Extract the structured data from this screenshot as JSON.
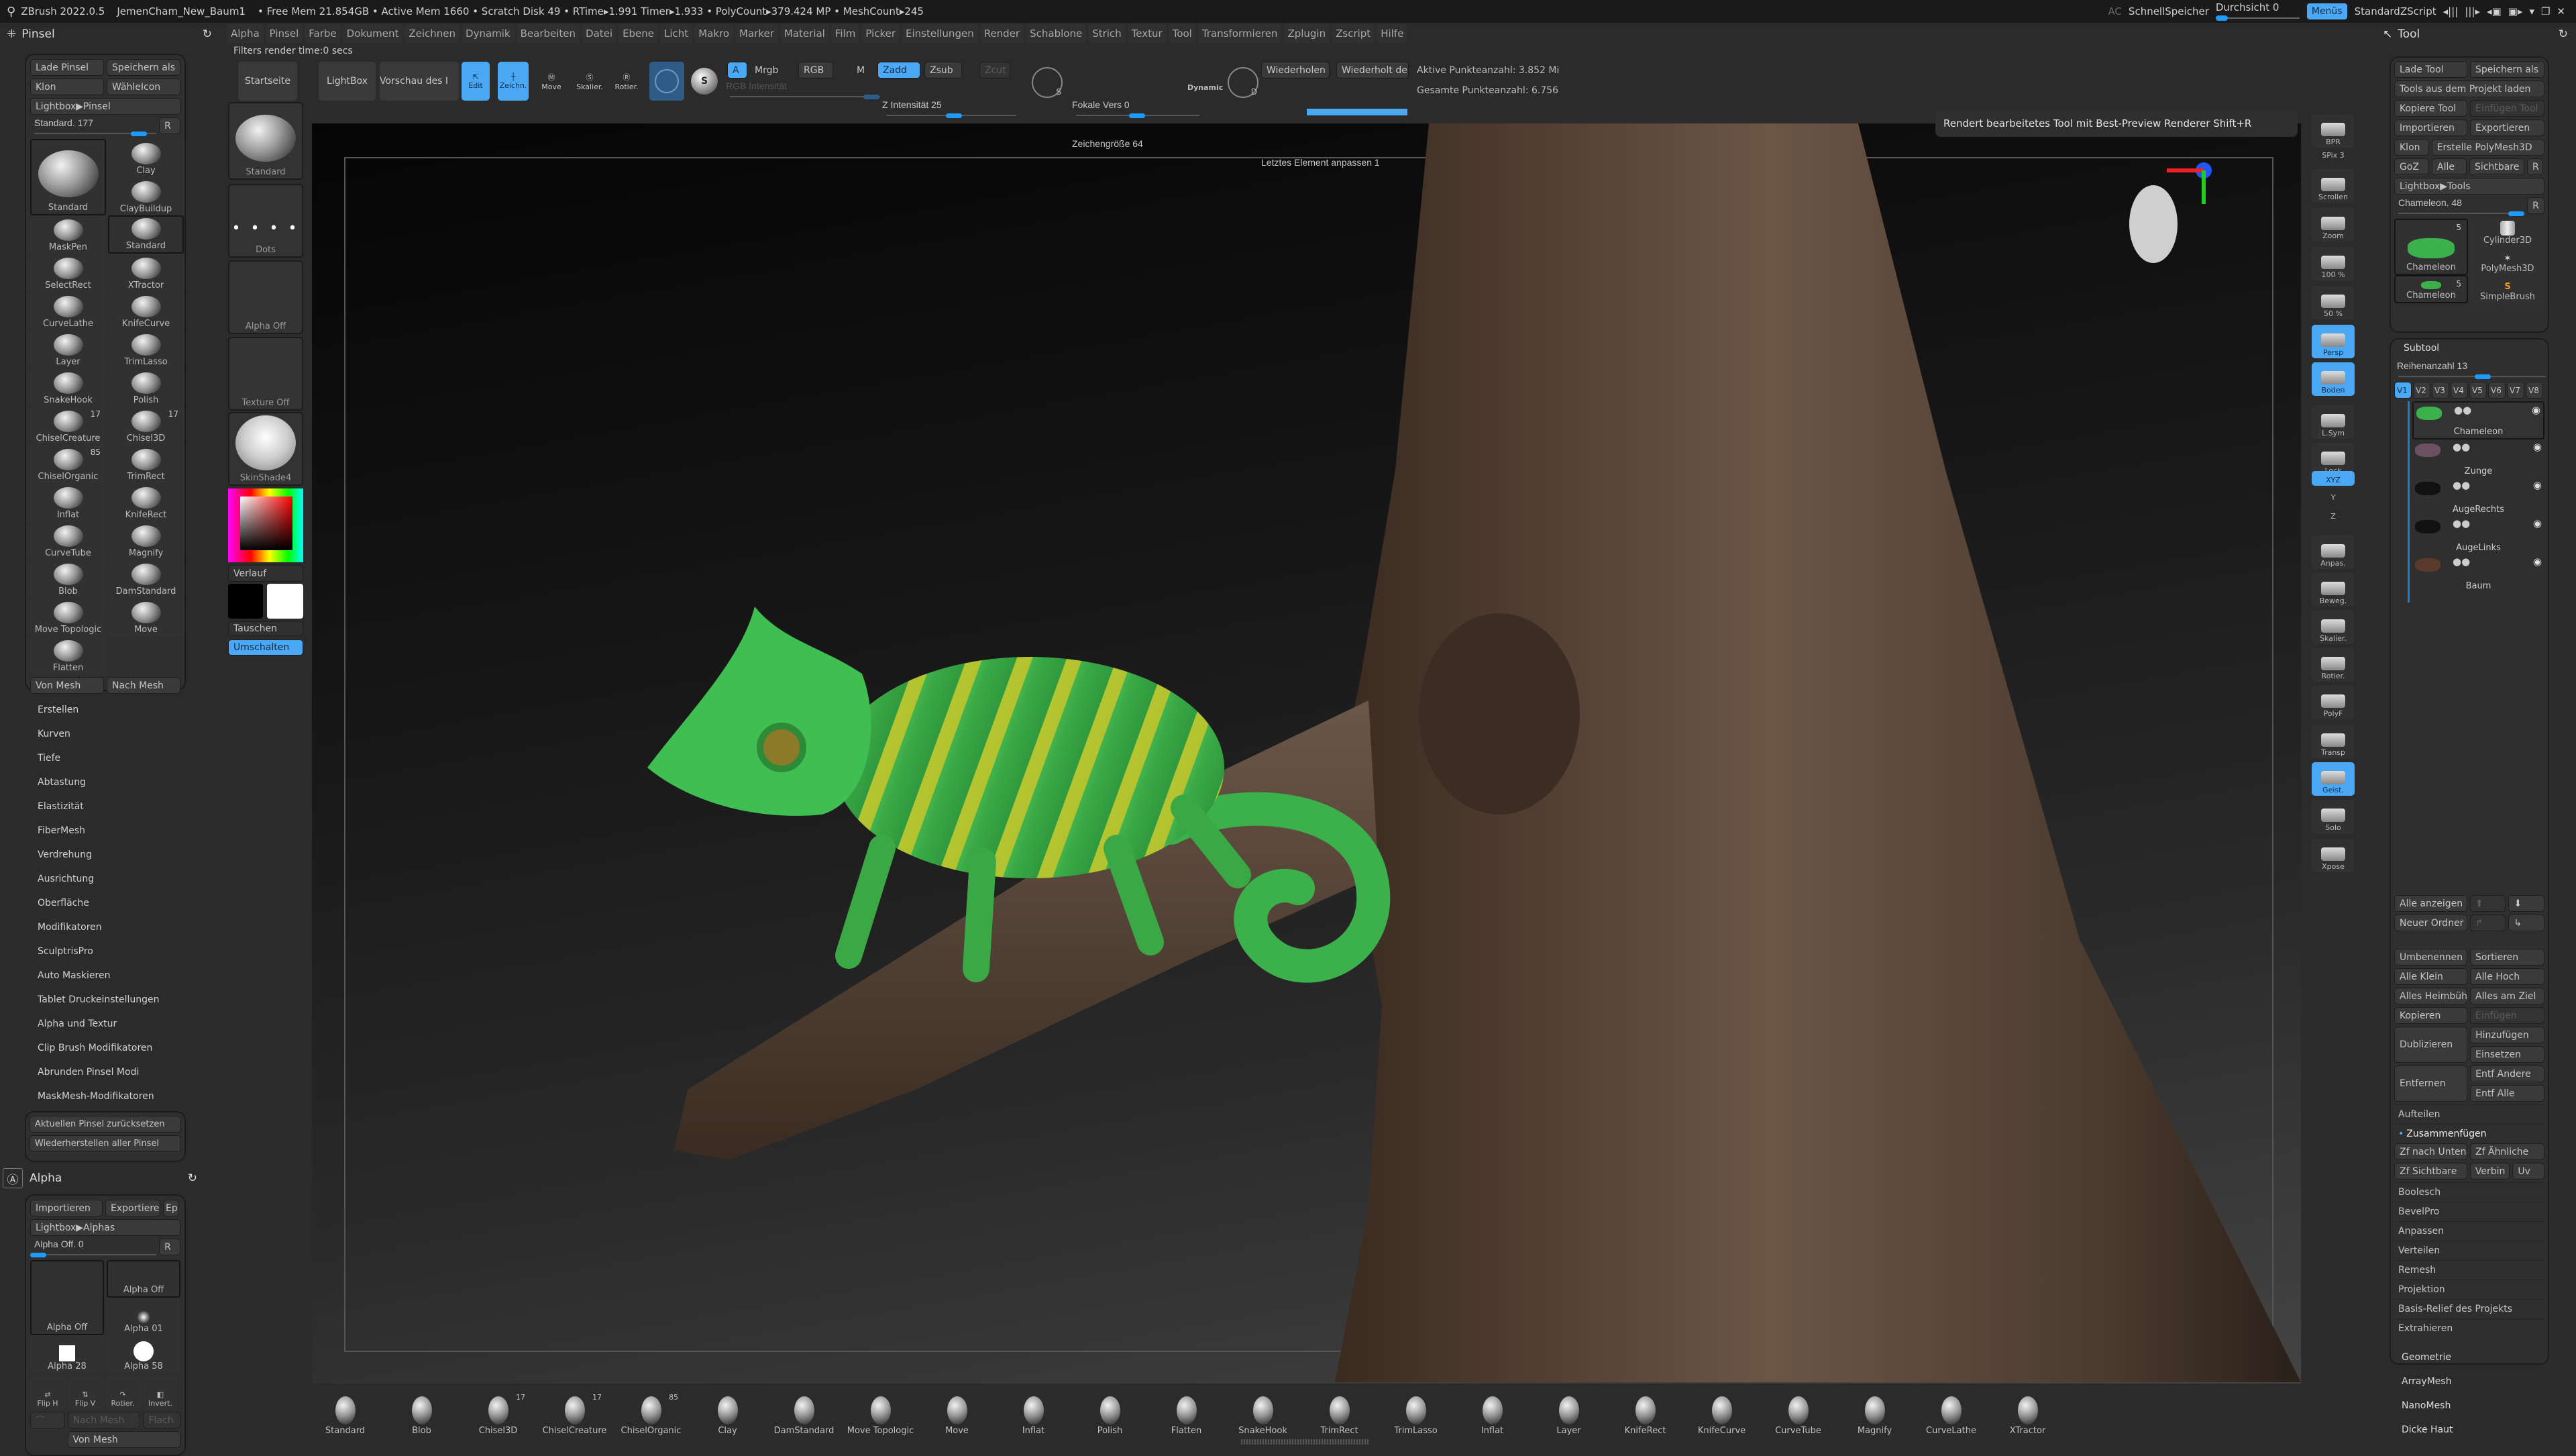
{
  "titlebar": {
    "app": "ZBrush 2022.0.5",
    "project": "JemenCham_New_Baum1",
    "stats": "• Free Mem 21.854GB • Active Mem 1660 • Scratch Disk 49 • RTime▸1.991 Timer▸1.933 • PolyCount▸379.424 MP • MeshCount▸245",
    "ac": "AC",
    "quicksave": "SchnellSpeicher",
    "transparency": "Durchsicht 0",
    "transparency_value": 0,
    "menus": "Menüs",
    "zscript": "StandardZScript"
  },
  "menubar": [
    "Alpha",
    "Pinsel",
    "Farbe",
    "Dokument",
    "Zeichnen",
    "Dynamik",
    "Bearbeiten",
    "Datei",
    "Ebene",
    "Licht",
    "Makro",
    "Marker",
    "Material",
    "Film",
    "Picker",
    "Einstellungen",
    "Render",
    "Schablone",
    "Strich",
    "Textur",
    "Tool",
    "Transformieren",
    "Zplugin",
    "Zscript",
    "Hilfe"
  ],
  "status": "Filters render time:0 secs",
  "toolbar": {
    "home": "Startseite",
    "lightbox": "LightBox",
    "preview": "Vorschau des I",
    "edit": "Edit",
    "draw": "Zeichn.",
    "move": "Move",
    "scale": "Skalier.",
    "rotate": "Rotier.",
    "a": "A",
    "mrgb": "Mrgb",
    "rgb": "RGB",
    "m": "M",
    "zadd": "Zadd",
    "zsub": "Zsub",
    "zcut": "Zcut",
    "rgb_intensity": "RGB Intensität",
    "z_intensity": "Z Intensität 25",
    "z_intensity_value": 25,
    "focal": "Fokale Vers 0",
    "draw_size": "Zeichengröße 64",
    "dynamic": "Dynamic",
    "repeat": "Wiederholen",
    "repeat_last": "Wiederholt de",
    "adjust_last": "Letztes Element anpassen 1",
    "active_points": "Aktive Punkteanzahl: 3.852 Mi",
    "total_points": "Gesamte Punkteanzahl: 6.756"
  },
  "tooltip": "Rendert bearbeitetes Tool mit Best-Preview Renderer  Shift+R",
  "brush_panel": {
    "title": "Pinsel",
    "load": "Lade Pinsel",
    "save_as": "Speichern als",
    "clone": "Klon",
    "select_icon": "WähleIcon",
    "lightbox": "Lightbox▶Pinsel",
    "slider": "Standard. 177",
    "r": "R",
    "brushes": [
      {
        "name": "Standard",
        "big": true
      },
      {
        "name": "Clay"
      },
      {
        "name": "ClayBuildup"
      },
      {
        "name": "MaskPen"
      },
      {
        "name": "Standard"
      },
      {
        "name": "SelectRect"
      },
      {
        "name": "XTractor"
      },
      {
        "name": "CurveLathe"
      },
      {
        "name": "KnifeCurve"
      },
      {
        "name": "Layer"
      },
      {
        "name": "TrimLasso"
      },
      {
        "name": "SnakeHook"
      },
      {
        "name": "Polish"
      },
      {
        "name": "ChiselCreature",
        "badge": "17"
      },
      {
        "name": "Chisel3D",
        "badge": "17"
      },
      {
        "name": "ChiselOrganic",
        "badge": "85"
      },
      {
        "name": "TrimRect"
      },
      {
        "name": "Inflat"
      },
      {
        "name": "KnifeRect"
      },
      {
        "name": "CurveTube"
      },
      {
        "name": "Magnify"
      },
      {
        "name": "Blob"
      },
      {
        "name": "DamStandard"
      },
      {
        "name": "Move Topologic"
      },
      {
        "name": "Move"
      },
      {
        "name": "Flatten"
      }
    ],
    "from_mesh": "Von Mesh",
    "to_mesh": "Nach Mesh",
    "menu": [
      "Erstellen",
      "Kurven",
      "Tiefe",
      "Abtastung",
      "Elastizität",
      "FiberMesh",
      "Verdrehung",
      "Ausrichtung",
      "Oberfläche",
      "Modifikatoren",
      "SculptrisPro",
      "Auto Maskieren",
      "Tablet Druckeinstellungen",
      "Alpha und Textur",
      "Clip Brush Modifikatoren",
      "Abrunden Pinsel Modi",
      "MaskMesh-Modifikatoren"
    ],
    "reset": "Aktuellen Pinsel zurücksetzen",
    "restore": "Wiederherstellen aller Pinsel"
  },
  "alpha_panel": {
    "title": "Alpha",
    "import": "Importieren",
    "export": "Exportiere",
    "ep": "Ep",
    "lightbox": "Lightbox▶Alphas",
    "slider": "Alpha Off. 0",
    "r": "R",
    "items": [
      "Alpha Off",
      "Alpha Off",
      "Alpha 01",
      "Alpha 28",
      "Alpha 58"
    ],
    "flip_h": "Flip H",
    "flip_v": "Flip V",
    "rotate": "Rotier.",
    "invert": "Invert.",
    "to_mesh": "Nach Mesh",
    "flat": "Flach",
    "from_mesh": "Von Mesh"
  },
  "side_column": {
    "brush": "Standard",
    "stroke": "Dots",
    "alpha": "Alpha Off",
    "texture": "Texture Off",
    "material": "SkinShade4",
    "gradient": "Verlauf",
    "swap": "Tauschen",
    "switch": "Umschalten",
    "main_color": "#000000",
    "secondary_color": "#ffffff"
  },
  "right_shelf": [
    {
      "label": "BPR"
    },
    {
      "label": "SPix 3",
      "slider": true
    },
    {
      "label": "Scrollen"
    },
    {
      "label": "Zoom"
    },
    {
      "label": "100 %"
    },
    {
      "label": "50 %"
    },
    {
      "label": "Persp",
      "active": true
    },
    {
      "label": "Boden",
      "active": true
    },
    {
      "label": "L.Sym"
    },
    {
      "label": "Lock"
    },
    {
      "label": "XYZ",
      "active": true
    },
    {
      "label": "Y"
    },
    {
      "label": "Z"
    },
    {
      "label": "Anpas."
    },
    {
      "label": "Beweg."
    },
    {
      "label": "Skalier."
    },
    {
      "label": "Rotier."
    },
    {
      "label": "PolyF"
    },
    {
      "label": "Transp"
    },
    {
      "label": "Geist.",
      "active": true
    },
    {
      "label": "Solo"
    },
    {
      "label": "Xpose"
    }
  ],
  "tool_panel": {
    "title": "Tool",
    "load": "Lade Tool",
    "save_as": "Speichern als",
    "load_project": "Tools aus dem Projekt laden",
    "copy": "Kopiere Tool",
    "paste": "Einfügen Tool",
    "import": "Importieren",
    "export": "Exportieren",
    "clone": "Klon",
    "make_polymesh": "Erstelle PolyMesh3D",
    "goz": "GoZ",
    "all": "Alle",
    "visible": "Sichtbare",
    "r": "R",
    "lightbox": "Lightbox▶Tools",
    "slider": "Chameleon. 48",
    "tools": [
      {
        "name": "Chameleon",
        "badge": "5"
      },
      {
        "name": "Cylinder3D"
      },
      {
        "name": "PolyMesh3D"
      },
      {
        "name": "Chameleon",
        "badge": "5"
      },
      {
        "name": "SimpleBrush"
      }
    ],
    "subtool": "Subtool",
    "rows": "Reihenanzahl 13",
    "versions": [
      "V1",
      "V2",
      "V3",
      "V4",
      "V5",
      "V6",
      "V7",
      "V8"
    ],
    "subtools": [
      "Chameleon",
      "Zunge",
      "AugeRechts",
      "AugeLinks",
      "Baum"
    ],
    "show_all": "Alle anzeigen",
    "new_folder": "Neuer Ordner",
    "rename": "Umbenennen",
    "sort": "Sortieren",
    "all_low": "Alle Klein",
    "all_high": "Alle Hoch",
    "all_home": "Alles Heimbüh",
    "all_target": "Alles am Ziel",
    "copy2": "Kopieren",
    "paste2": "Einfügen",
    "duplicate": "Dublizieren",
    "append": "Hinzufügen",
    "insert": "Einsetzen",
    "delete": "Entfernen",
    "del_other": "Entf Andere",
    "del_all": "Entf Alle",
    "split": "Aufteilen",
    "merge": "Zusammenfügen",
    "merge_down": "Zf nach Unten",
    "merge_similar": "Zf Ähnliche",
    "merge_visible": "Zf Sichtbare",
    "weld": "Verbin",
    "uv": "Uv",
    "list": [
      "Boolesch",
      "BevelPro",
      "Anpassen",
      "Verteilen",
      "Remesh",
      "Projektion",
      "Basis-Relief des Projekts",
      "Extrahieren"
    ],
    "sections": [
      "Geometrie",
      "ArrayMesh",
      "NanoMesh",
      "Dicke Haut"
    ]
  },
  "bottom_shelf": [
    {
      "name": "Standard"
    },
    {
      "name": "Blob"
    },
    {
      "name": "Chisel3D",
      "badge": "17"
    },
    {
      "name": "ChiselCreature",
      "badge": "17"
    },
    {
      "name": "ChiselOrganic",
      "badge": "85"
    },
    {
      "name": "Clay"
    },
    {
      "name": "DamStandard"
    },
    {
      "name": "Move Topologic"
    },
    {
      "name": "Move"
    },
    {
      "name": "Inflat"
    },
    {
      "name": "Polish"
    },
    {
      "name": "Flatten"
    },
    {
      "name": "SnakeHook"
    },
    {
      "name": "TrimRect"
    },
    {
      "name": "TrimLasso"
    },
    {
      "name": "Inflat"
    },
    {
      "name": "Layer"
    },
    {
      "name": "KnifeRect"
    },
    {
      "name": "KnifeCurve"
    },
    {
      "name": "CurveTube"
    },
    {
      "name": "Magnify"
    },
    {
      "name": "CurveLathe"
    },
    {
      "name": "XTractor"
    }
  ],
  "colors": {
    "accent": "#4aa8f5",
    "slider": "#1e9bff",
    "panel": "#2b2b2b"
  }
}
